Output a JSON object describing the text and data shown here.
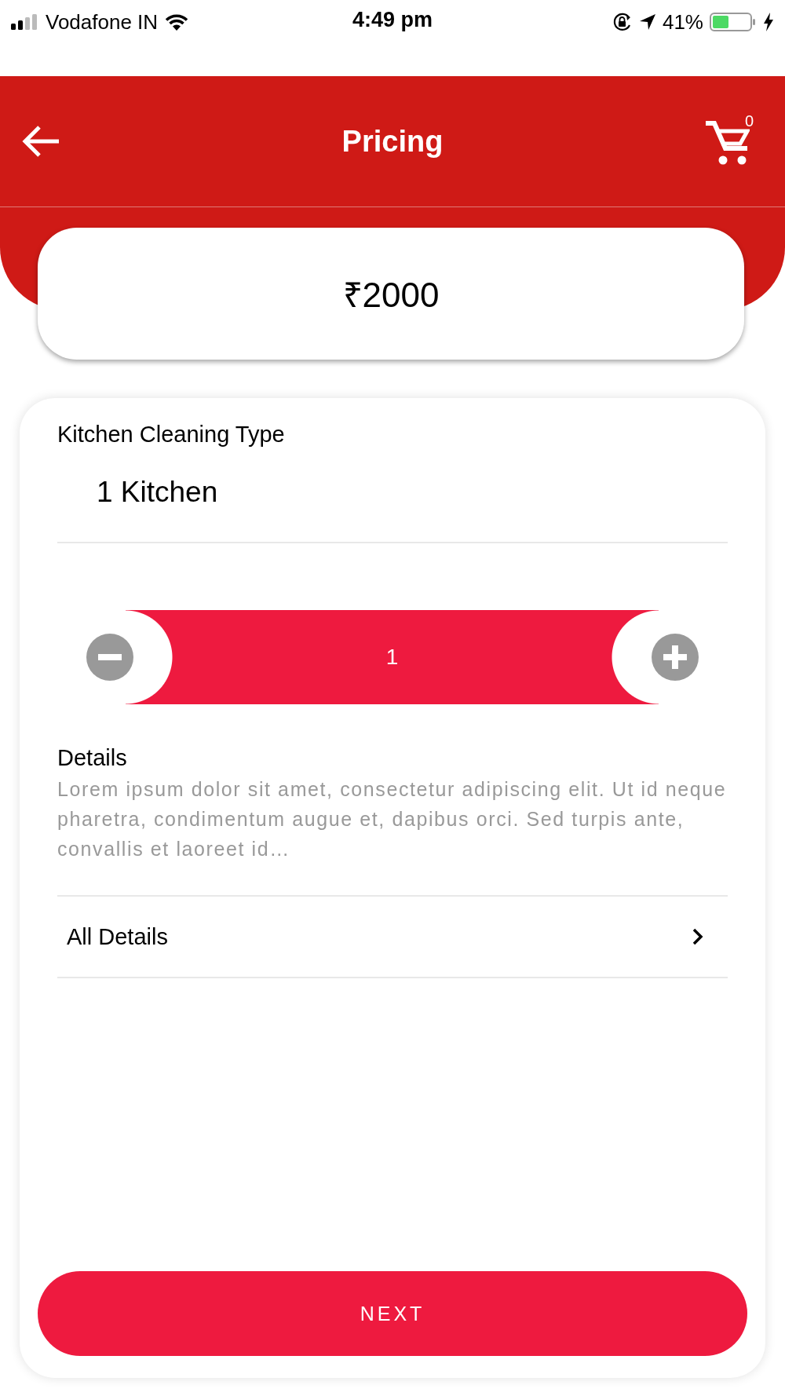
{
  "status_bar": {
    "carrier": "Vodafone IN",
    "time": "4:49 pm",
    "battery": "41%"
  },
  "header": {
    "title": "Pricing",
    "cart_count": "0"
  },
  "price": "₹2000",
  "service": {
    "label": "Kitchen Cleaning Type",
    "value": "1 Kitchen"
  },
  "quantity": {
    "value": "1"
  },
  "details": {
    "title": "Details",
    "text": "Lorem ipsum dolor sit amet, consectetur adipiscing elit. Ut id neque pharetra, condimentum augue et, dapibus orci. Sed turpis ante, convallis et laoreet id…"
  },
  "all_details": {
    "label": "All Details"
  },
  "next_button": "NEXT"
}
